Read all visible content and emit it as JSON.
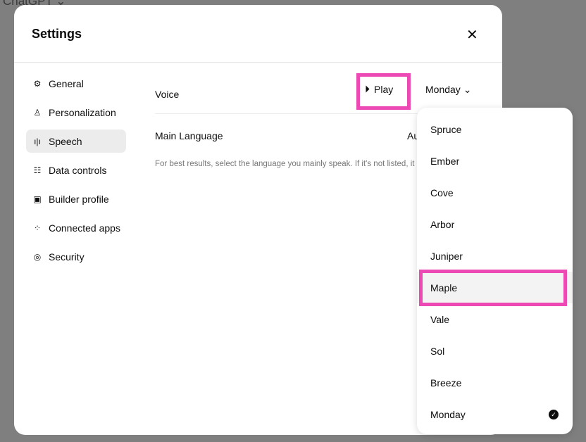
{
  "app_title": "ChatGPT ⌄",
  "dialog": {
    "title": "Settings",
    "close": "✕"
  },
  "nav": [
    {
      "label": "General",
      "icon": "⚙"
    },
    {
      "label": "Personalization",
      "icon": "♙"
    },
    {
      "label": "Speech",
      "icon": "ı|ı"
    },
    {
      "label": "Data controls",
      "icon": "☷"
    },
    {
      "label": "Builder profile",
      "icon": "▣"
    },
    {
      "label": "Connected apps",
      "icon": "⁘"
    },
    {
      "label": "Security",
      "icon": "◎"
    }
  ],
  "speech": {
    "voice_label": "Voice",
    "play_label": "Play",
    "voice_value": "Monday ⌄",
    "language_label": "Main Language",
    "language_value": "Au",
    "hint": "For best results, select the language you mainly speak. If it's not listed, it may still be supported via auto-detection."
  },
  "voices": [
    "Spruce",
    "Ember",
    "Cove",
    "Arbor",
    "Juniper",
    "Maple",
    "Vale",
    "Sol",
    "Breeze",
    "Monday"
  ],
  "selected_voice": "Monday",
  "check": "✓"
}
